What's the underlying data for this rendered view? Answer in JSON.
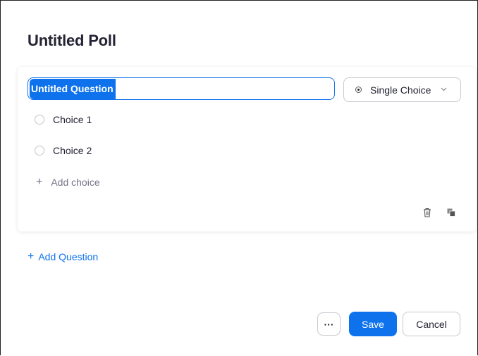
{
  "poll": {
    "title": "Untitled Poll",
    "question": {
      "value": "Untitled Question",
      "type_label": "Single Choice",
      "choices": [
        {
          "label": "Choice 1"
        },
        {
          "label": "Choice 2"
        }
      ],
      "add_choice_label": "Add choice",
      "add_choice_icon": "+"
    },
    "add_question_label": "Add Question",
    "add_question_icon": "+"
  },
  "footer": {
    "more_label": "···",
    "save_label": "Save",
    "cancel_label": "Cancel"
  },
  "colors": {
    "accent": "#0e72ed",
    "text": "#232333",
    "muted": "#747487"
  },
  "icons": {
    "type_select": "radio-icon",
    "type_chevron": "chevron-down-icon",
    "delete": "trash-icon",
    "duplicate": "copy-icon"
  }
}
